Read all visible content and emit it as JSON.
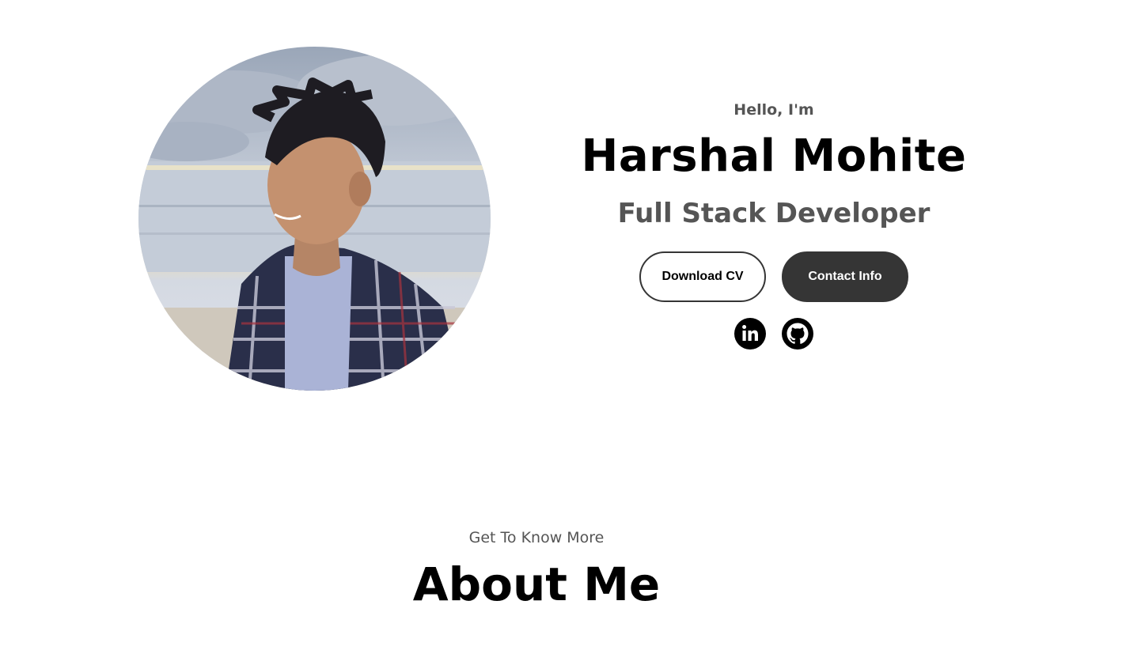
{
  "profile": {
    "image_alt": "profile picture"
  },
  "hero": {
    "greeting": "Hello, I'm",
    "name": "Harshal Mohite",
    "role": "Full Stack Developer",
    "buttons": {
      "download_cv": "Download CV",
      "contact_info": "Contact Info"
    },
    "socials": [
      {
        "icon": "linkedin-icon"
      },
      {
        "icon": "github-icon"
      }
    ]
  },
  "about": {
    "subtitle": "Get To Know More",
    "title": "About Me"
  },
  "colors": {
    "primary_dark": "#353535",
    "text_muted": "#555555",
    "background": "#ffffff"
  }
}
